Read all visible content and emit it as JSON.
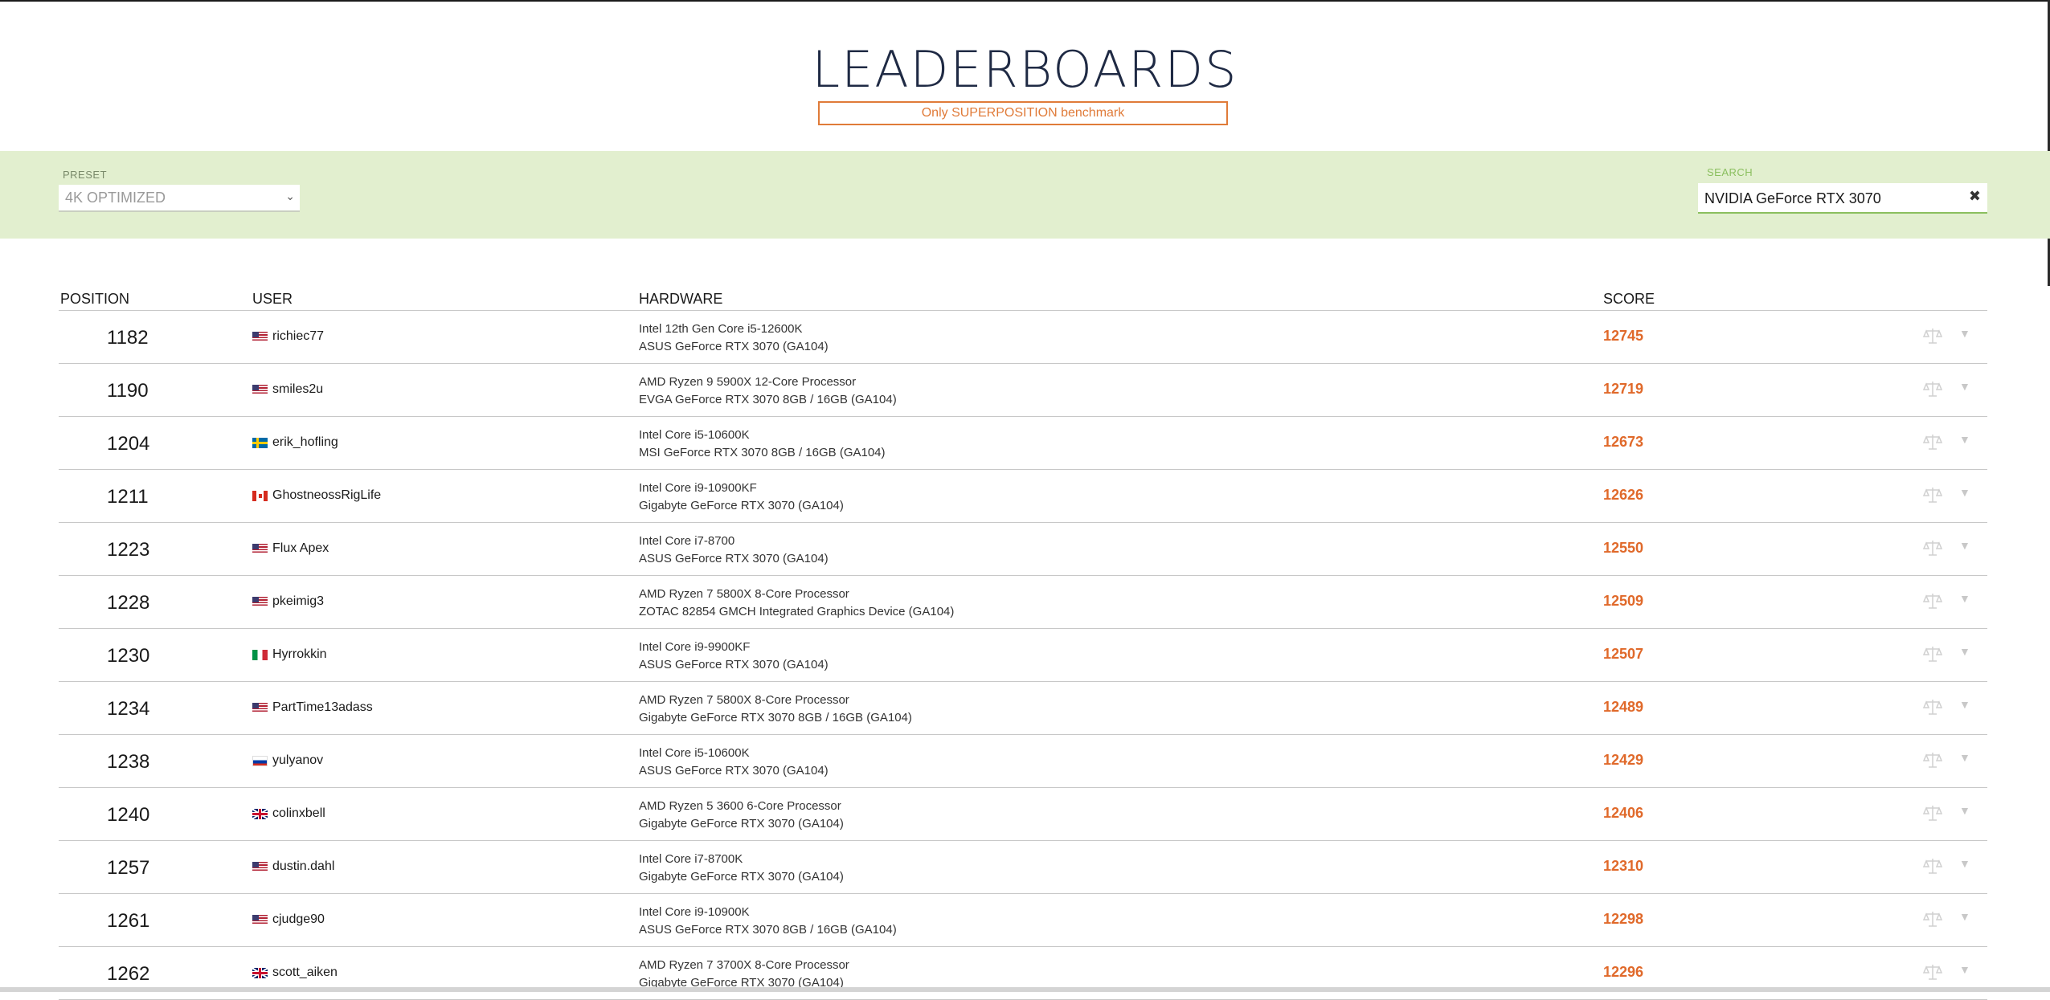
{
  "header": {
    "title": "LEADERBOARDS",
    "subtitle": "Only SUPERPOSITION benchmark"
  },
  "filters": {
    "preset_label": "PRESET",
    "preset_value": "4K OPTIMIZED",
    "search_label": "SEARCH",
    "search_value": "NVIDIA GeForce RTX 3070"
  },
  "table": {
    "columns": {
      "position": "POSITION",
      "user": "USER",
      "hardware": "HARDWARE",
      "score": "SCORE"
    },
    "rows": [
      {
        "position": "1182",
        "flag": "us",
        "user": "richiec77",
        "cpu": "Intel 12th Gen Core i5-12600K",
        "gpu": "ASUS GeForce RTX 3070 (GA104)",
        "score": "12745"
      },
      {
        "position": "1190",
        "flag": "us",
        "user": "smiles2u",
        "cpu": "AMD Ryzen 9 5900X 12-Core Processor",
        "gpu": "EVGA GeForce RTX 3070 8GB / 16GB (GA104)",
        "score": "12719"
      },
      {
        "position": "1204",
        "flag": "se",
        "user": "erik_hofling",
        "cpu": "Intel Core i5-10600K",
        "gpu": "MSI GeForce RTX 3070 8GB / 16GB (GA104)",
        "score": "12673"
      },
      {
        "position": "1211",
        "flag": "ca",
        "user": "GhostneossRigLife",
        "cpu": "Intel Core i9-10900KF",
        "gpu": "Gigabyte GeForce RTX 3070 (GA104)",
        "score": "12626"
      },
      {
        "position": "1223",
        "flag": "us",
        "user": "Flux Apex",
        "cpu": "Intel Core i7-8700",
        "gpu": "ASUS GeForce RTX 3070 (GA104)",
        "score": "12550"
      },
      {
        "position": "1228",
        "flag": "us",
        "user": "pkeimig3",
        "cpu": "AMD Ryzen 7 5800X 8-Core Processor",
        "gpu": "ZOTAC 82854 GMCH Integrated Graphics Device (GA104)",
        "score": "12509"
      },
      {
        "position": "1230",
        "flag": "it",
        "user": "Hyrrokkin",
        "cpu": "Intel Core i9-9900KF",
        "gpu": "ASUS GeForce RTX 3070 (GA104)",
        "score": "12507"
      },
      {
        "position": "1234",
        "flag": "us",
        "user": "PartTime13adass",
        "cpu": "AMD Ryzen 7 5800X 8-Core Processor",
        "gpu": "Gigabyte GeForce RTX 3070 8GB / 16GB (GA104)",
        "score": "12489"
      },
      {
        "position": "1238",
        "flag": "ru",
        "user": "yulyanov",
        "cpu": "Intel Core i5-10600K",
        "gpu": "ASUS GeForce RTX 3070 (GA104)",
        "score": "12429"
      },
      {
        "position": "1240",
        "flag": "gb",
        "user": "colinxbell",
        "cpu": "AMD Ryzen 5 3600 6-Core Processor",
        "gpu": "Gigabyte GeForce RTX 3070 (GA104)",
        "score": "12406"
      },
      {
        "position": "1257",
        "flag": "us",
        "user": "dustin.dahl",
        "cpu": "Intel Core i7-8700K",
        "gpu": "Gigabyte GeForce RTX 3070 (GA104)",
        "score": "12310"
      },
      {
        "position": "1261",
        "flag": "us",
        "user": "cjudge90",
        "cpu": "Intel Core i9-10900K",
        "gpu": "ASUS GeForce RTX 3070 8GB / 16GB (GA104)",
        "score": "12298"
      },
      {
        "position": "1262",
        "flag": "gb",
        "user": "scott_aiken",
        "cpu": "AMD Ryzen 7 3700X 8-Core Processor",
        "gpu": "Gigabyte GeForce RTX 3070 (GA104)",
        "score": "12296"
      }
    ]
  },
  "icons": {
    "compare": "scale-icon",
    "expand": "chevron-down-icon",
    "clear": "close-icon"
  },
  "colors": {
    "accent": "#e0692a",
    "filter_bg": "#e2efcf",
    "search_accent": "#8bbf5f"
  }
}
